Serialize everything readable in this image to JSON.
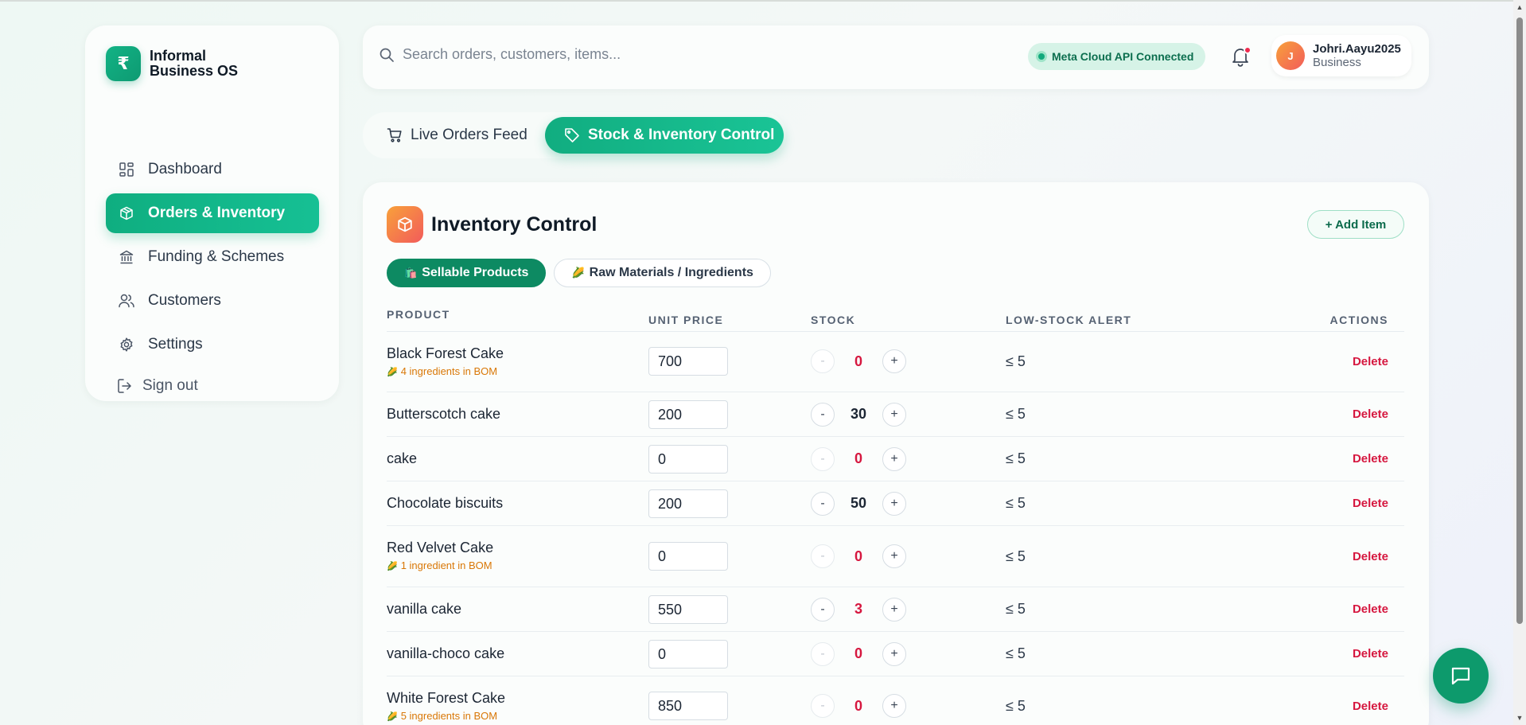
{
  "brand": {
    "logo_symbol": "₹",
    "name_line1": "Informal",
    "name_line2": "Business OS"
  },
  "sidebar": {
    "items": [
      {
        "label": "Dashboard",
        "icon": "dashboard-icon",
        "active": false
      },
      {
        "label": "Orders & Inventory",
        "icon": "box-icon",
        "active": true
      },
      {
        "label": "Funding & Schemes",
        "icon": "bank-icon",
        "active": false
      },
      {
        "label": "Customers",
        "icon": "users-icon",
        "active": false
      },
      {
        "label": "Settings",
        "icon": "gear-icon",
        "active": false
      }
    ],
    "signout_label": "Sign out"
  },
  "header": {
    "search_placeholder": "Search orders, customers, items...",
    "api_status": "Meta Cloud API Connected",
    "user": {
      "initial": "J",
      "name": "Johri.Aayu2025",
      "role": "Business"
    }
  },
  "tabs": [
    {
      "label": "Live Orders Feed",
      "icon": "cart-icon",
      "active": false
    },
    {
      "label": "Stock & Inventory Control",
      "icon": "tag-icon",
      "active": true
    }
  ],
  "inventory": {
    "title": "Inventory Control",
    "add_label": "+ Add Item",
    "subtabs": [
      {
        "label": "Sellable Products",
        "emoji": "🛍️",
        "active": true
      },
      {
        "label": "Raw Materials / Ingredients",
        "emoji": "🌽",
        "active": false
      }
    ],
    "columns": {
      "product": "PRODUCT",
      "unit_price": "UNIT PRICE",
      "stock": "STOCK",
      "low_stock_alert": "LOW-STOCK ALERT",
      "actions": "ACTIONS"
    },
    "minus_label": "-",
    "plus_label": "+",
    "delete_label": "Delete",
    "rows": [
      {
        "name": "Black Forest Cake",
        "bom": "4 ingredients in BOM",
        "price": "700",
        "stock": "0",
        "alert": "≤ 5"
      },
      {
        "name": "Butterscotch cake",
        "bom": "",
        "price": "200",
        "stock": "30",
        "alert": "≤ 5"
      },
      {
        "name": "cake",
        "bom": "",
        "price": "0",
        "stock": "0",
        "alert": "≤ 5"
      },
      {
        "name": "Chocolate biscuits",
        "bom": "",
        "price": "200",
        "stock": "50",
        "alert": "≤ 5"
      },
      {
        "name": "Red Velvet Cake",
        "bom": "1 ingredient in BOM",
        "price": "0",
        "stock": "0",
        "alert": "≤ 5"
      },
      {
        "name": "vanilla cake",
        "bom": "",
        "price": "550",
        "stock": "3",
        "alert": "≤ 5"
      },
      {
        "name": "vanilla-choco cake",
        "bom": "",
        "price": "0",
        "stock": "0",
        "alert": "≤ 5"
      },
      {
        "name": "White Forest Cake",
        "bom": "5 ingredients in BOM",
        "price": "850",
        "stock": "0",
        "alert": "≤ 5"
      }
    ]
  },
  "colors": {
    "accent": "#12b385",
    "danger": "#d6173f",
    "bom": "#d97706"
  }
}
